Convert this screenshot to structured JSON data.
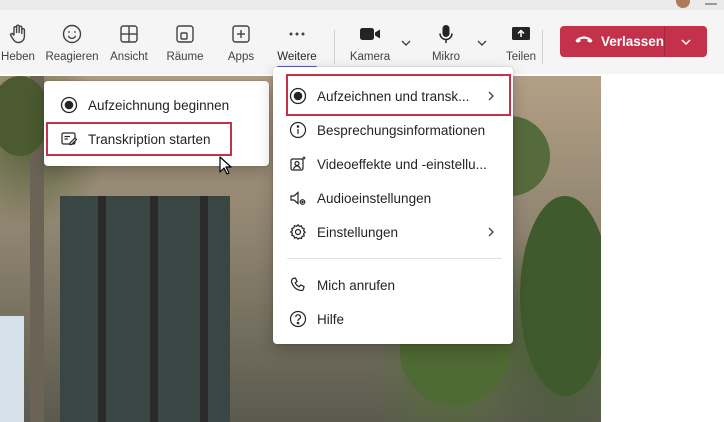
{
  "toolbar": {
    "items": [
      {
        "label": "Heben",
        "icon": "raise-hand-icon"
      },
      {
        "label": "Reagieren",
        "icon": "smiley-icon"
      },
      {
        "label": "Ansicht",
        "icon": "grid-view-icon"
      },
      {
        "label": "Räume",
        "icon": "breakout-rooms-icon"
      },
      {
        "label": "Apps",
        "icon": "add-app-icon"
      },
      {
        "label": "Weitere",
        "icon": "more-dots-icon"
      },
      {
        "label": "Kamera",
        "icon": "camera-icon"
      },
      {
        "label": "Mikro",
        "icon": "microphone-icon"
      },
      {
        "label": "Teilen",
        "icon": "share-screen-icon"
      }
    ],
    "leave_label": "Verlassen"
  },
  "submenu": {
    "items": [
      {
        "label": "Aufzeichnung beginnen",
        "icon": "record-icon"
      },
      {
        "label": "Transkription starten",
        "icon": "transcript-icon"
      }
    ]
  },
  "more_menu": {
    "items": [
      {
        "label": "Aufzeichnen und transk...",
        "icon": "record-icon"
      },
      {
        "label": "Besprechungsinformationen",
        "icon": "info-icon"
      },
      {
        "label": "Videoeffekte und -einstellu...",
        "icon": "video-effects-icon"
      },
      {
        "label": "Audioeinstellungen",
        "icon": "speaker-settings-icon"
      },
      {
        "label": "Einstellungen",
        "icon": "gear-icon"
      },
      {
        "label": "Mich anrufen",
        "icon": "phone-icon"
      },
      {
        "label": "Hilfe",
        "icon": "help-icon"
      }
    ]
  },
  "colors": {
    "accent": "#5b5fc7",
    "leave_button": "#c4314b",
    "highlight_box": "#c4314b"
  }
}
